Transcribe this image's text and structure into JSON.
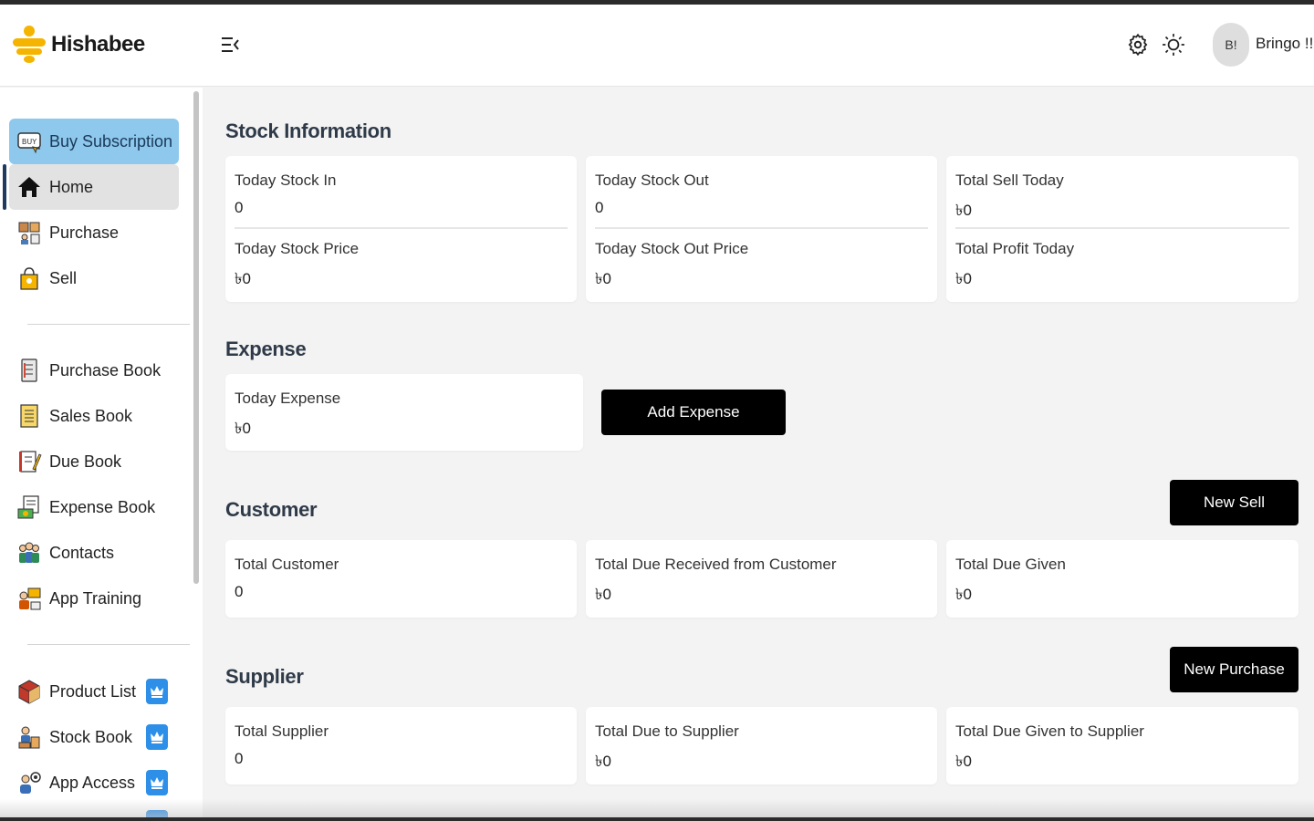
{
  "header": {
    "brand": "Hishabee",
    "avatar_initials": "B!",
    "username": "Bringo !!"
  },
  "sidebar": {
    "items": [
      {
        "label": "Buy Subscription"
      },
      {
        "label": "Home"
      },
      {
        "label": "Purchase"
      },
      {
        "label": "Sell"
      },
      {
        "label": "Purchase Book"
      },
      {
        "label": "Sales Book"
      },
      {
        "label": "Due Book"
      },
      {
        "label": "Expense Book"
      },
      {
        "label": "Contacts"
      },
      {
        "label": "App Training"
      },
      {
        "label": "Product List"
      },
      {
        "label": "Stock Book"
      },
      {
        "label": "App Access"
      }
    ]
  },
  "stock": {
    "title": "Stock Information",
    "cards": [
      {
        "top_label": "Today Stock In",
        "top_value": "0",
        "bottom_label": "Today Stock Price",
        "bottom_value": "৳0"
      },
      {
        "top_label": "Today Stock Out",
        "top_value": "0",
        "bottom_label": "Today Stock Out Price",
        "bottom_value": "৳0"
      },
      {
        "top_label": "Total Sell Today",
        "top_value": "৳0",
        "bottom_label": "Total Profit Today",
        "bottom_value": "৳0"
      }
    ]
  },
  "expense": {
    "title": "Expense",
    "card": {
      "label": "Today Expense",
      "value": "৳0"
    },
    "add_button": "Add Expense"
  },
  "customer": {
    "title": "Customer",
    "button": "New Sell",
    "cards": [
      {
        "label": "Total Customer",
        "value": "0"
      },
      {
        "label": "Total Due Received from Customer",
        "value": "৳0"
      },
      {
        "label": "Total Due Given",
        "value": "৳0"
      }
    ]
  },
  "supplier": {
    "title": "Supplier",
    "button": "New Purchase",
    "cards": [
      {
        "label": "Total Supplier",
        "value": "0"
      },
      {
        "label": "Total Due to Supplier",
        "value": "৳0"
      },
      {
        "label": "Total Due Given to Supplier",
        "value": "৳0"
      }
    ]
  },
  "colors": {
    "subscription_bg": "#8ec8ec",
    "active_bg": "#e2e2e2",
    "crown": "#2d8fe8",
    "button": "#000000"
  },
  "icons": {
    "menu_toggle": "menu-collapse-icon",
    "settings": "gear-icon",
    "theme": "sun-icon",
    "premium": "crown-icon"
  }
}
